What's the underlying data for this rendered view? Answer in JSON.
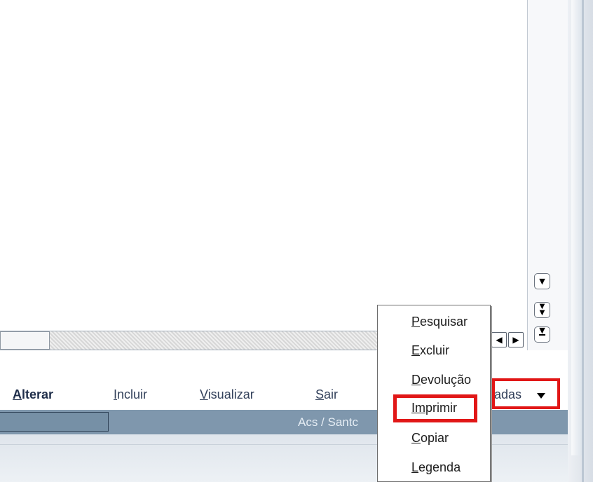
{
  "toolbar": {
    "alterar": {
      "mnemonic": "A",
      "rest": "lterar"
    },
    "incluir": {
      "mnemonic": "I",
      "rest": "ncluir"
    },
    "visualizar": {
      "mnemonic": "V",
      "rest": "isualizar"
    },
    "sair": {
      "mnemonic": "S",
      "rest": "air"
    },
    "related_actions_visible": "adas"
  },
  "popup_menu": {
    "items": [
      {
        "mnemonic": "P",
        "rest": "esquisar"
      },
      {
        "mnemonic": "E",
        "rest": "xcluir"
      },
      {
        "mnemonic": "D",
        "rest": "evolução"
      },
      {
        "mnemonic": "Im",
        "rest": "primir",
        "highlighted": true
      },
      {
        "mnemonic": "C",
        "rest": "opiar"
      },
      {
        "mnemonic": "L",
        "rest": "egenda"
      }
    ]
  },
  "status_bar": {
    "text": "Acs / Santc"
  },
  "icons": {
    "scroll_left": "left-arrow-icon",
    "scroll_right": "right-arrow-icon",
    "page_down": "down-arrow-icon",
    "fast_down": "double-down-arrow-icon",
    "last": "bottom-arrow-icon",
    "dropdown": "caret-down-icon"
  },
  "colors": {
    "highlight_red": "#e11717",
    "statusbar": "#7f97ad"
  }
}
